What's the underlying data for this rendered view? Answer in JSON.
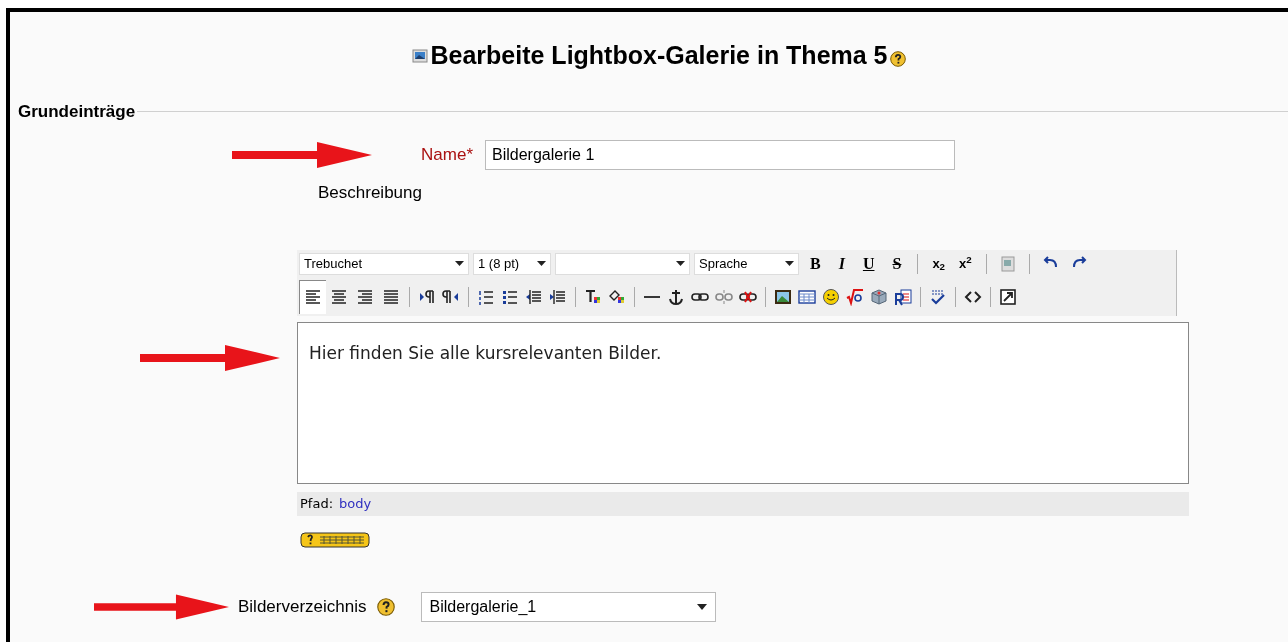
{
  "title": "Bearbeite Lightbox-Galerie in Thema 5",
  "section": "Grundeinträge",
  "name_field": {
    "label": "Name*",
    "value": "Bildergalerie 1"
  },
  "description": {
    "label": "Beschreibung",
    "toolbar": {
      "selects": [
        {
          "value": "Trebuchet"
        },
        {
          "value": "1 (8 pt)"
        },
        {
          "value": "Sprache"
        }
      ],
      "format_buttons": [
        {
          "label": "B"
        },
        {
          "label": "I"
        },
        {
          "label": "U"
        },
        {
          "label": "S"
        }
      ],
      "script_buttons": [
        {
          "label": "x$_{2}$"
        },
        {
          "label": "x$^{2}$"
        }
      ],
      "align_buttons": [
        {
          "selected": true
        },
        {
          "selected": false
        },
        {
          "selected": false
        },
        {
          "selected": false
        }
      ]
    },
    "text": "Hier finden Sie alle kursrelevanten Bilder.",
    "path_label": "Pfad:",
    "path_link": "body"
  },
  "folder_field": {
    "label": "Bilderverzeichnis",
    "value": "Bildergalerie_1"
  }
}
